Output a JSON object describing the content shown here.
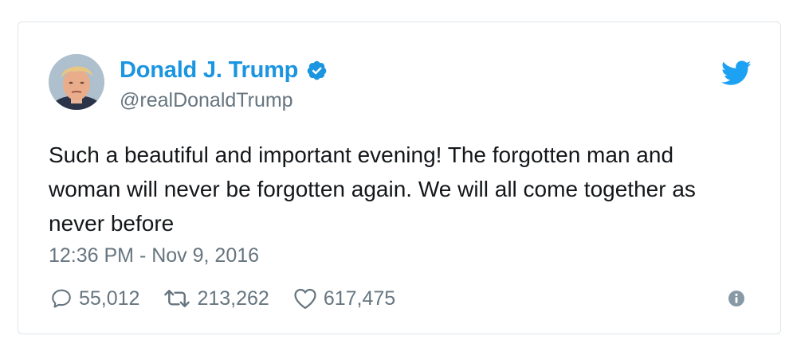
{
  "tweet": {
    "author": {
      "display_name": "Donald J. Trump",
      "handle": "@realDonaldTrump",
      "verified": true
    },
    "text": "Such a beautiful and important evening! The forgotten man and woman will never be forgotten again. We will all come together as never before",
    "timestamp": "12:36 PM - Nov 9, 2016",
    "stats": {
      "replies": "55,012",
      "retweets": "213,262",
      "likes": "617,475"
    }
  },
  "icons": {
    "avatar": "avatar",
    "verified": "verified-badge-icon",
    "brand": "twitter-bird-icon",
    "reply": "reply-icon",
    "retweet": "retweet-icon",
    "like": "heart-icon",
    "info": "info-icon"
  },
  "colors": {
    "accent": "#1b95e0",
    "text": "#14171a",
    "secondary_text": "#66757f",
    "border": "#dfe5e9"
  }
}
